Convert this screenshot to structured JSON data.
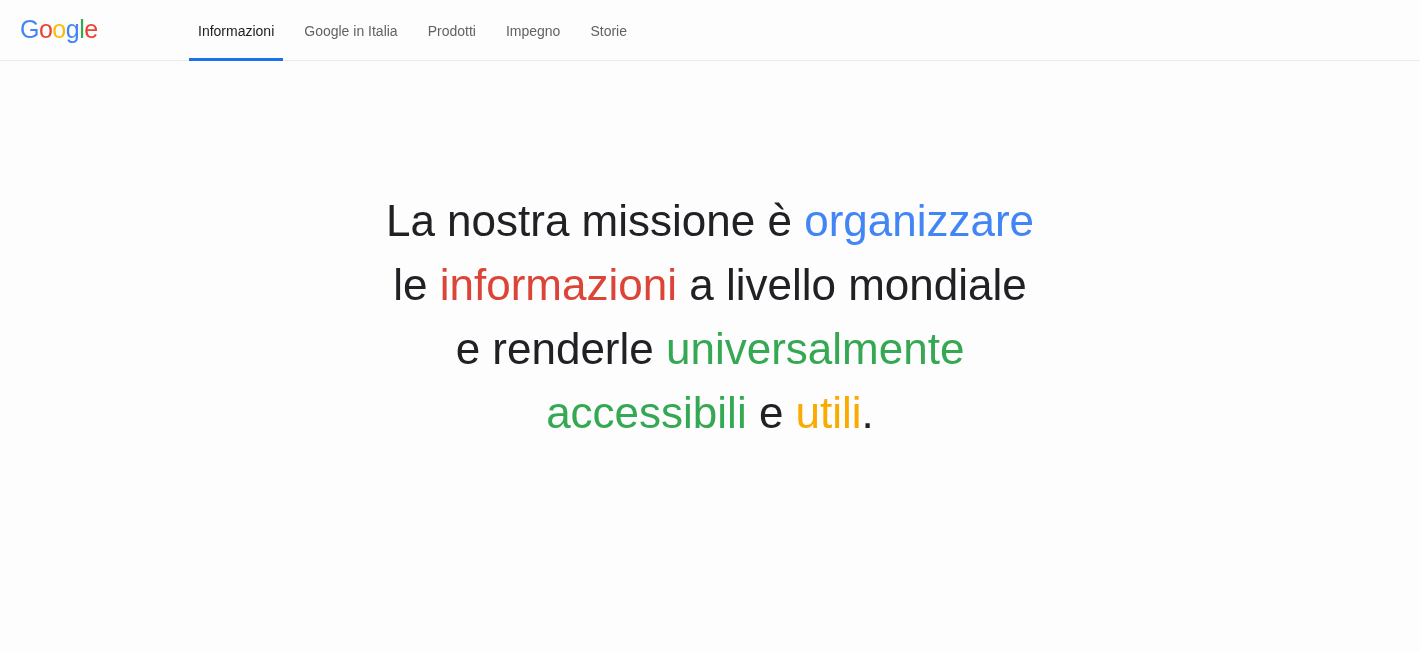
{
  "header": {
    "logo": [
      {
        "letter": "G",
        "color": "#4285f4"
      },
      {
        "letter": "o",
        "color": "#ea4335"
      },
      {
        "letter": "o",
        "color": "#fbbc05"
      },
      {
        "letter": "g",
        "color": "#4285f4"
      },
      {
        "letter": "l",
        "color": "#34a853"
      },
      {
        "letter": "e",
        "color": "#ea4335"
      }
    ],
    "tabs": [
      {
        "label": "Informazioni",
        "selected": true
      },
      {
        "label": "Google in Italia",
        "selected": false
      },
      {
        "label": "Prodotti",
        "selected": false
      },
      {
        "label": "Impegno",
        "selected": false
      },
      {
        "label": "Storie",
        "selected": false
      }
    ]
  },
  "mission": {
    "lines": [
      {
        "segments": [
          {
            "text": "La nostra missione è ",
            "color": "#202124"
          },
          {
            "text": "organizzare",
            "color": "#4285f4"
          }
        ]
      },
      {
        "segments": [
          {
            "text": "le ",
            "color": "#202124"
          },
          {
            "text": "informazioni",
            "color": "#db4437"
          },
          {
            "text": " a livello mondiale",
            "color": "#202124"
          }
        ]
      },
      {
        "segments": [
          {
            "text": "e renderle ",
            "color": "#202124"
          },
          {
            "text": "universalmente",
            "color": "#34a853"
          }
        ]
      },
      {
        "segments": [
          {
            "text": "accessibili",
            "color": "#34a853"
          },
          {
            "text": " e ",
            "color": "#202124"
          },
          {
            "text": "utili",
            "color": "#f9ab00"
          },
          {
            "text": ".",
            "color": "#202124"
          }
        ]
      }
    ]
  }
}
